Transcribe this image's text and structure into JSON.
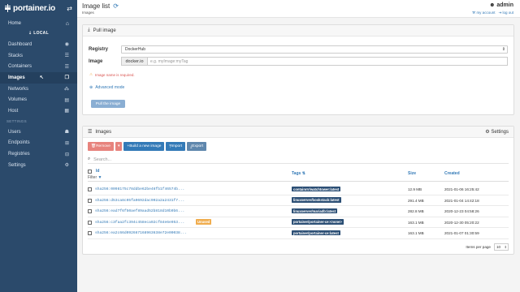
{
  "brand": {
    "name": "portainer.io",
    "toggle_icon": "arrows-swap-icon"
  },
  "sidebar": {
    "home": "Home",
    "endpoint": "LOCAL",
    "items": [
      {
        "label": "Dashboard",
        "icon": "dashboard-icon",
        "glyph": "◉"
      },
      {
        "label": "Stacks",
        "icon": "stacks-icon",
        "glyph": "☰"
      },
      {
        "label": "Containers",
        "icon": "containers-icon",
        "glyph": "☰"
      },
      {
        "label": "Images",
        "icon": "images-icon",
        "glyph": "❐"
      },
      {
        "label": "Networks",
        "icon": "networks-icon",
        "glyph": "⁂"
      },
      {
        "label": "Volumes",
        "icon": "volumes-icon",
        "glyph": "▤"
      },
      {
        "label": "Host",
        "icon": "host-icon",
        "glyph": "▦"
      }
    ],
    "settings_section": "SETTINGS",
    "settings_items": [
      {
        "label": "Users",
        "icon": "users-icon",
        "glyph": "☗"
      },
      {
        "label": "Endpoints",
        "icon": "endpoints-icon",
        "glyph": "⊞"
      },
      {
        "label": "Registries",
        "icon": "registries-icon",
        "glyph": "⊟"
      },
      {
        "label": "Settings",
        "icon": "settings-icon",
        "glyph": "⚙"
      }
    ]
  },
  "header": {
    "title": "Image list",
    "breadcrumb": "Images",
    "user": "admin",
    "my_account": "my account",
    "log_out": "log out"
  },
  "pull": {
    "title": "Pull image",
    "registry_label": "Registry",
    "registry_value": "DockerHub",
    "image_label": "Image",
    "image_prefix": "docker.io",
    "image_placeholder": "e.g. myImage:myTag",
    "warning": "Image name is required.",
    "advanced": "Advanced mode",
    "button": "Pull the image"
  },
  "images": {
    "title": "Images",
    "settings": "Settings",
    "actions": {
      "remove": "Remove",
      "build": "Build a new image",
      "import": "Import",
      "export": "Export"
    },
    "search_placeholder": "Search...",
    "columns": {
      "id": "Id",
      "filter": "Filter",
      "tags": "Tags",
      "size": "Size",
      "created": "Created"
    },
    "rows": [
      {
        "id": "sha256:0098175c78ddbe62be46fb1f46574b...",
        "unused": "",
        "tag": "containrrr/watchtower:latest",
        "size": "12.9 MB",
        "created": "2021-01-06 16:25:42"
      },
      {
        "id": "sha256:d53ca8c05fa0692dac902a2a2431f7...",
        "unused": "",
        "tag": "linuxserver/bookstack:latest",
        "size": "291.4 MB",
        "created": "2021-01-04 14:42:18"
      },
      {
        "id": "sha256:ead7f6f50aef89aad52b818d10b9b6...",
        "unused": "",
        "tag": "linuxserver/mariadb:latest",
        "size": "282.8 MB",
        "created": "2020-12-23 04:58:26"
      },
      {
        "id": "sha256:c3faa2fc394c458eca92cf84e6e953...",
        "unused": "Unused",
        "tag": "portainer/portainer-ce:<none>",
        "size": "163.1 MB",
        "created": "2020-12-30 05:20:22"
      },
      {
        "id": "sha256:ea2c66d092667168963638e72e00038...",
        "unused": "",
        "tag": "portainer/portainer-ce:latest",
        "size": "163.1 MB",
        "created": "2021-01-07 01:30:59"
      }
    ],
    "items_per_page_label": "Items per page",
    "items_per_page": "10"
  }
}
